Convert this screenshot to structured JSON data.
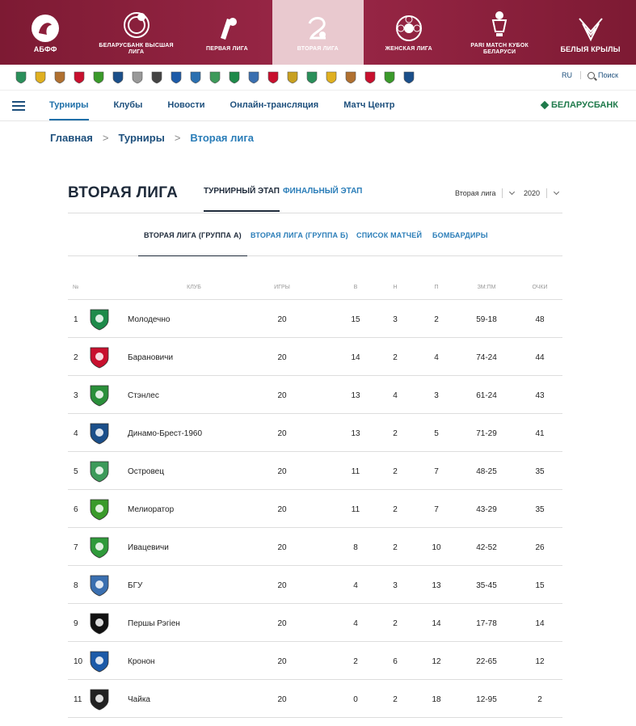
{
  "banner": {
    "items": [
      {
        "label": "АБФФ"
      },
      {
        "label": "Беларусбанк Высшая лига"
      },
      {
        "label": "Первая лига"
      },
      {
        "label": "Вторая лига",
        "active": true
      },
      {
        "label": "Женская лига"
      },
      {
        "label": "PARI MATCH Кубок Беларуси"
      },
      {
        "label": "Белыя крылы"
      }
    ]
  },
  "clubs_strip": {
    "icon_count": 21,
    "lang": "RU",
    "search_label": "Поиск"
  },
  "nav": {
    "items": [
      {
        "label": "Турниры",
        "active": true
      },
      {
        "label": "Клубы"
      },
      {
        "label": "Новости"
      },
      {
        "label": "Онлайн-трансляция"
      },
      {
        "label": "Матч Центр"
      }
    ],
    "sponsor": "БЕЛАРУСБАНК"
  },
  "breadcrumb": {
    "items": [
      "Главная",
      "Турниры",
      "Вторая лига"
    ]
  },
  "title": {
    "text": "ВТОРАЯ ЛИГА",
    "stage_tabs": [
      "ТУРНИРНЫЙ ЭТАП",
      "ФИНАЛЬНЫЙ ЭТАП"
    ],
    "league_select": "Вторая лига",
    "year_select": "2020"
  },
  "subtabs": [
    "ВТОРАЯ ЛИГА (ГРУППА А)",
    "ВТОРАЯ ЛИГА (ГРУППА Б)",
    "СПИСОК МАТЧЕЙ",
    "БОМБАРДИРЫ"
  ],
  "table": {
    "headers": [
      "№",
      "КЛУБ",
      "ИГРЫ",
      "В",
      "Н",
      "П",
      "ЗМ:ПМ",
      "ОЧКИ"
    ],
    "rows": [
      {
        "pos": "1",
        "club": "Молодечно",
        "games": "20",
        "w": "15",
        "d": "3",
        "l": "2",
        "goals": "59-18",
        "pts": "48",
        "color": "#1e8a4a"
      },
      {
        "pos": "2",
        "club": "Барановичи",
        "games": "20",
        "w": "14",
        "d": "2",
        "l": "4",
        "goals": "74-24",
        "pts": "44",
        "color": "#c8102e"
      },
      {
        "pos": "3",
        "club": "Стэнлес",
        "games": "20",
        "w": "13",
        "d": "4",
        "l": "3",
        "goals": "61-24",
        "pts": "43",
        "color": "#2a8f3a"
      },
      {
        "pos": "4",
        "club": "Динамо-Брест-1960",
        "games": "20",
        "w": "13",
        "d": "2",
        "l": "5",
        "goals": "71-29",
        "pts": "41",
        "color": "#1b4f8a"
      },
      {
        "pos": "5",
        "club": "Островец",
        "games": "20",
        "w": "11",
        "d": "2",
        "l": "7",
        "goals": "48-25",
        "pts": "35",
        "color": "#3d9a5a"
      },
      {
        "pos": "6",
        "club": "Мелиоратор",
        "games": "20",
        "w": "11",
        "d": "2",
        "l": "7",
        "goals": "43-29",
        "pts": "35",
        "color": "#3a9a2a"
      },
      {
        "pos": "7",
        "club": "Ивацевичи",
        "games": "20",
        "w": "8",
        "d": "2",
        "l": "10",
        "goals": "42-52",
        "pts": "26",
        "color": "#2f9a3a"
      },
      {
        "pos": "8",
        "club": "БГУ",
        "games": "20",
        "w": "4",
        "d": "3",
        "l": "13",
        "goals": "35-45",
        "pts": "15",
        "color": "#3a6fb0"
      },
      {
        "pos": "9",
        "club": "Першы Рэгіен",
        "games": "20",
        "w": "4",
        "d": "2",
        "l": "14",
        "goals": "17-78",
        "pts": "14",
        "color": "#111111"
      },
      {
        "pos": "10",
        "club": "Кронон",
        "games": "20",
        "w": "2",
        "d": "6",
        "l": "12",
        "goals": "22-65",
        "pts": "12",
        "color": "#1c5aa8"
      },
      {
        "pos": "11",
        "club": "Чайка",
        "games": "20",
        "w": "0",
        "d": "2",
        "l": "18",
        "goals": "12-95",
        "pts": "2",
        "color": "#222222"
      }
    ]
  },
  "colors": {
    "banner": "#8c1f3a",
    "banner_active": "#e9c9cf",
    "link": "#2a7db8",
    "nav": "#1d4f7c",
    "sponsor": "#1f7a4b"
  }
}
